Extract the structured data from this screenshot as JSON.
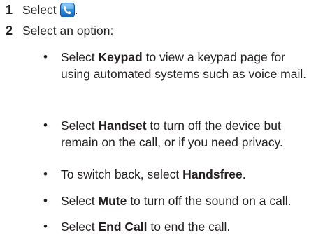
{
  "steps": [
    {
      "number": "1",
      "text_before": "Select",
      "icon": "phone-call-icon",
      "text_after": "."
    },
    {
      "number": "2",
      "text": "Select an option:"
    }
  ],
  "bullets": [
    {
      "prefix": "Select ",
      "bold": "Keypad",
      "suffix": " to view a keypad page for using automated systems such as voice mail."
    },
    {
      "prefix": "Select ",
      "bold": "Handset",
      "suffix": " to turn off the device but remain on the call, or if you need privacy."
    },
    {
      "prefix": "To switch back, select ",
      "bold": "Handsfree",
      "suffix": "."
    },
    {
      "prefix": "Select ",
      "bold": "Mute",
      "suffix": " to turn off the sound on a call."
    },
    {
      "prefix": "Select ",
      "bold": "End Call",
      "suffix": " to end the call."
    }
  ],
  "bullet_glyph": "•",
  "colors": {
    "text": "#231f20",
    "icon_blue": "#1f73c8",
    "icon_blue_light": "#5fb0ee"
  }
}
